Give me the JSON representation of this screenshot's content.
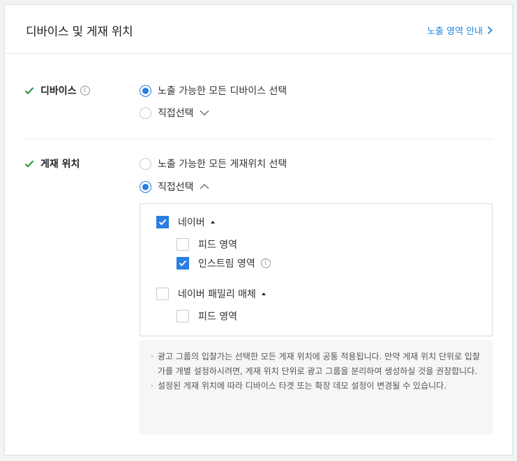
{
  "header": {
    "title": "디바이스 및 게재 위치",
    "guide_link": "노출 영역 안내"
  },
  "device": {
    "label": "디바이스",
    "options": [
      {
        "label": "노출 가능한 모든 디바이스 선택",
        "selected": true
      },
      {
        "label": "직접선택",
        "selected": false
      }
    ]
  },
  "placement": {
    "label": "게재 위치",
    "options": [
      {
        "label": "노출 가능한 모든 게재위치 선택",
        "selected": false
      },
      {
        "label": "직접선택",
        "selected": true
      }
    ],
    "groups": [
      {
        "label": "네이버",
        "checked": true,
        "children": [
          {
            "label": "피드 영역",
            "checked": false
          },
          {
            "label": "인스트림 영역",
            "checked": true
          }
        ]
      },
      {
        "label": "네이버 패밀리 매체",
        "checked": false,
        "children": [
          {
            "label": "피드 영역",
            "checked": false
          }
        ]
      }
    ]
  },
  "notice": {
    "bullet": "·",
    "items": [
      "광고 그룹의 입찰가는 선택한 모든 게재 위치에 공통 적용됩니다. 만약 게재 위치 단위로 입찰가를 개별 설정하시려면, 게재 위치 단위로 광고 그룹을 분리하여 생성하실 것을 권장합니다.",
      "설정된 게재 위치에 따라 디바이스 타겟 또는 확장 데모 설정이 변경될 수 있습니다."
    ]
  },
  "colors": {
    "accent": "#2a7de1",
    "link": "#1e88e5",
    "check": "#2e9e3c"
  }
}
